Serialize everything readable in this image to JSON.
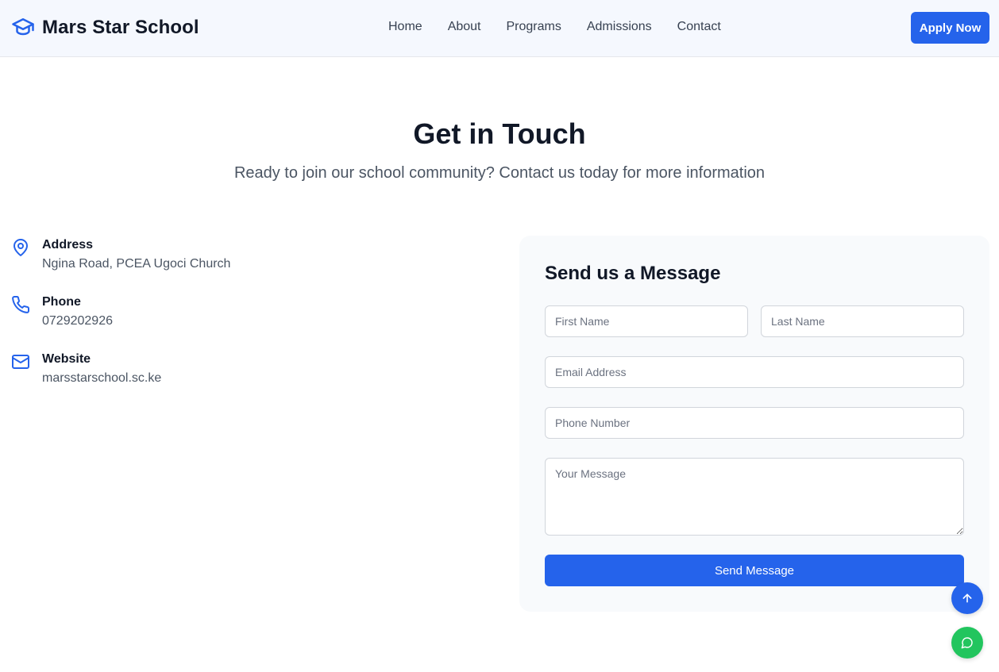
{
  "header": {
    "brand": "Mars Star School",
    "nav": [
      "Home",
      "About",
      "Programs",
      "Admissions",
      "Contact"
    ],
    "apply_label": "Apply Now"
  },
  "hero": {
    "title": "Get in Touch",
    "subtitle": "Ready to join our school community? Contact us today for more information"
  },
  "contact": {
    "items": [
      {
        "label": "Address",
        "value": "Ngina Road, PCEA Ugoci Church",
        "icon": "map-pin-icon"
      },
      {
        "label": "Phone",
        "value": "0729202926",
        "icon": "phone-icon"
      },
      {
        "label": "Website",
        "value": "marsstarschool.sc.ke",
        "icon": "mail-icon"
      }
    ]
  },
  "form": {
    "title": "Send us a Message",
    "first_name_placeholder": "First Name",
    "last_name_placeholder": "Last Name",
    "email_placeholder": "Email Address",
    "phone_placeholder": "Phone Number",
    "message_placeholder": "Your Message",
    "submit_label": "Send Message"
  },
  "floating": {
    "scroll_top_icon": "arrow-up-icon",
    "chat_icon": "chat-bubble-icon"
  },
  "colors": {
    "primary": "#2563eb",
    "chat": "#22c55e",
    "header_bg": "#f5f8fe",
    "card_bg": "#f8fafc"
  }
}
